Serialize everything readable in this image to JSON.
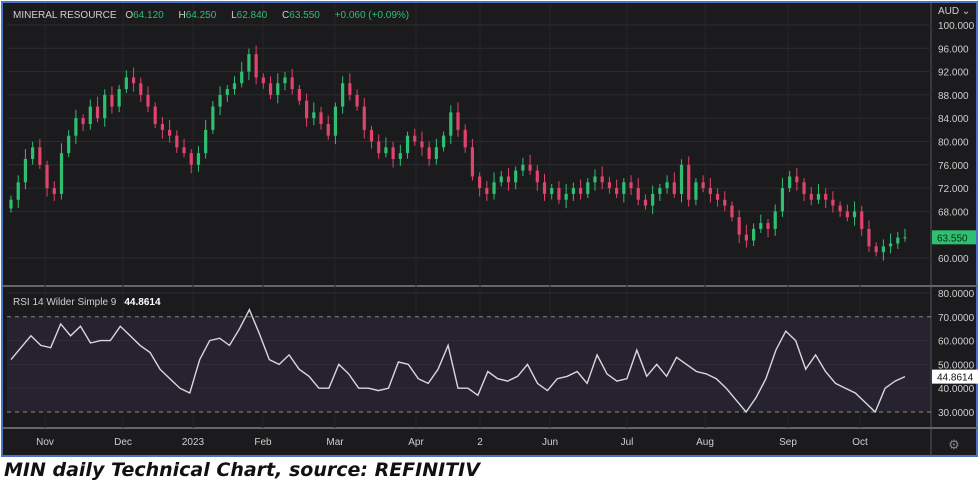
{
  "header": {
    "symbol": "MINERAL RESOURCE",
    "open_label": "O",
    "open": "64.120",
    "high_label": "H",
    "high": "64.250",
    "low_label": "L",
    "low": "62.840",
    "close_label": "C",
    "close": "63.550",
    "change": "+0.060 (+0.09%)"
  },
  "currency": "AUD",
  "last_price_tag": "63.550",
  "rsi_header": {
    "label": "RSI 14 Wilder Simple 9",
    "value": "44.8614"
  },
  "caption": "MIN daily Technical Chart, source: REFINITIV",
  "colors": {
    "up": "#2fbf71",
    "down": "#e0436b",
    "background": "#1b1b1d",
    "rsi_band": "#262230",
    "rsi_line": "#d8d8d8"
  },
  "chart_data": [
    {
      "type": "candlestick",
      "title": "MINERAL RESOURCE",
      "ylabel": "AUD",
      "ylim": [
        56,
        102
      ],
      "yticks": [
        "100.000",
        "96.000",
        "92.000",
        "88.000",
        "84.000",
        "80.000",
        "76.000",
        "72.000",
        "68.000",
        "60.000"
      ],
      "close": [
        70,
        73,
        77,
        79,
        76,
        72,
        71,
        78,
        81,
        84,
        83,
        86,
        84,
        88,
        86,
        89,
        91,
        90,
        88,
        86,
        83,
        82,
        81,
        79,
        78,
        76,
        78,
        82,
        86,
        88,
        89,
        90,
        92,
        95,
        91,
        90,
        88,
        90,
        91,
        89,
        87,
        84,
        85,
        83,
        81,
        86,
        90,
        88,
        86,
        82,
        80,
        78,
        79,
        77,
        78,
        81,
        80,
        79,
        77,
        79,
        81,
        85,
        82,
        79,
        74,
        72,
        71,
        73,
        74,
        73,
        75,
        76,
        75,
        73,
        71,
        72,
        70,
        71,
        72,
        71,
        73,
        74,
        73,
        72,
        71,
        73,
        72,
        70,
        69,
        71,
        72,
        73,
        71,
        76,
        70,
        73,
        72,
        71,
        70,
        69,
        67,
        64,
        63,
        65,
        66,
        65,
        68,
        72,
        74,
        73,
        71,
        70,
        71,
        70,
        69,
        68,
        67,
        68,
        65,
        62,
        61,
        62,
        62.5,
        63.5,
        63.55
      ],
      "first_open": 68.5
    },
    {
      "type": "line",
      "title": "RSI 14 Wilder Simple 9",
      "ylim": [
        25,
        80
      ],
      "yticks": [
        "80.0000",
        "70.0000",
        "60.0000",
        "50.0000",
        "40.0000",
        "30.0000"
      ],
      "bands": [
        30,
        70
      ],
      "values": [
        52,
        57,
        62,
        58,
        57,
        67,
        62,
        66,
        59,
        60,
        60,
        66,
        62,
        58,
        55,
        48,
        44,
        40,
        38,
        52,
        60,
        61,
        58,
        65,
        73,
        63,
        52,
        50,
        54,
        48,
        45,
        40,
        40,
        50,
        46,
        40,
        40,
        39,
        40,
        51,
        50,
        44,
        42,
        48,
        58,
        40,
        40,
        37,
        47,
        44,
        43,
        45,
        50,
        42,
        39,
        44,
        45,
        47,
        42,
        54,
        46,
        43,
        44,
        56,
        45,
        50,
        45,
        53,
        50,
        47,
        46,
        44,
        40,
        35,
        30,
        36,
        44,
        56,
        64,
        60,
        48,
        54,
        47,
        42,
        40,
        38,
        34,
        30,
        40,
        43,
        44.86
      ]
    },
    {
      "type": "axis",
      "xticks": [
        "Nov",
        "Dec",
        "2023",
        "Feb",
        "Mar",
        "Apr",
        "2",
        "Jun",
        "Jul",
        "Aug",
        "Sep",
        "Oct"
      ]
    }
  ]
}
